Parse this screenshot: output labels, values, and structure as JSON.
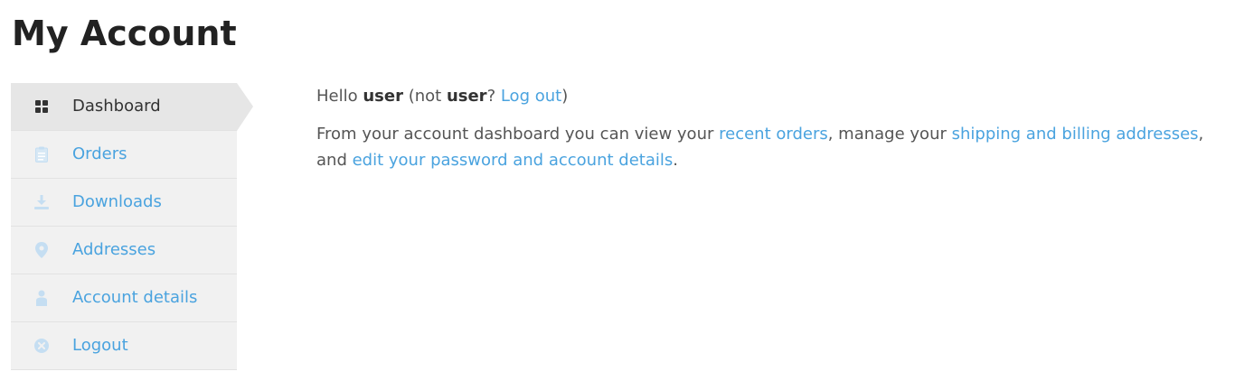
{
  "page": {
    "title": "My Account"
  },
  "nav": {
    "items": [
      {
        "label": "Dashboard",
        "icon": "dashboard-icon",
        "active": true
      },
      {
        "label": "Orders",
        "icon": "clipboard-icon"
      },
      {
        "label": "Downloads",
        "icon": "download-icon"
      },
      {
        "label": "Addresses",
        "icon": "map-pin-icon"
      },
      {
        "label": "Account details",
        "icon": "user-icon"
      },
      {
        "label": "Logout",
        "icon": "close-circle-icon"
      }
    ]
  },
  "content": {
    "greeting": {
      "hello": "Hello ",
      "username": "user",
      "not_open": " (not ",
      "username2": "user",
      "question": "? ",
      "logout_link": "Log out",
      "close": ")"
    },
    "description": {
      "part1": "From your account dashboard you can view your ",
      "recent_orders_link": "recent orders",
      "part2": ", manage your ",
      "addresses_link": "shipping and billing addresses",
      "part3": ", and ",
      "account_link": "edit your password and account details",
      "part4": "."
    }
  },
  "colors": {
    "link": "#4aa3df",
    "nav_bg": "#f1f1f1",
    "nav_active_bg": "#e6e6e6",
    "icon_muted": "#c5def2",
    "icon_active": "#333333",
    "title": "#222222",
    "text": "#555555"
  }
}
